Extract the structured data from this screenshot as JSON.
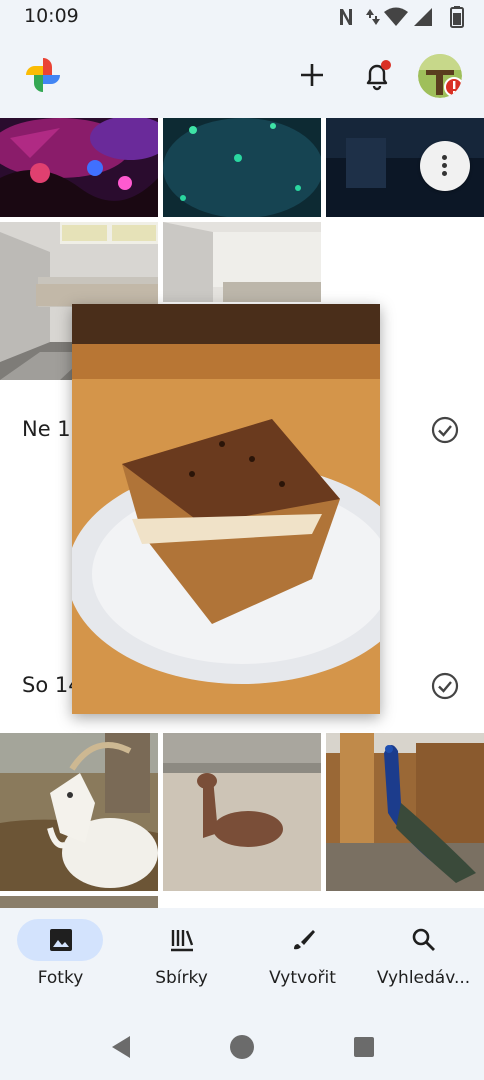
{
  "status_bar": {
    "time": "10:09"
  },
  "header": {
    "logo_icon": "pinwheel-icon",
    "add_icon": "plus-icon",
    "notifications_icon": "bell-icon",
    "avatar_icon": "avatar-with-alert-icon"
  },
  "sections": [
    {
      "date": "Ne 15"
    },
    {
      "date": "So 14"
    }
  ],
  "nav": {
    "items": [
      {
        "label": "Fotky",
        "icon": "photo-icon",
        "active": true
      },
      {
        "label": "Sbírky",
        "icon": "library-icon",
        "active": false
      },
      {
        "label": "Vytvořit",
        "icon": "brush-icon",
        "active": false
      },
      {
        "label": "Vyhledáv...",
        "icon": "search-icon",
        "active": false
      }
    ]
  },
  "colors": {
    "bar_bg": "#f0f4f9",
    "active_pill": "#d3e3fd",
    "notification_dot": "#d93025"
  }
}
